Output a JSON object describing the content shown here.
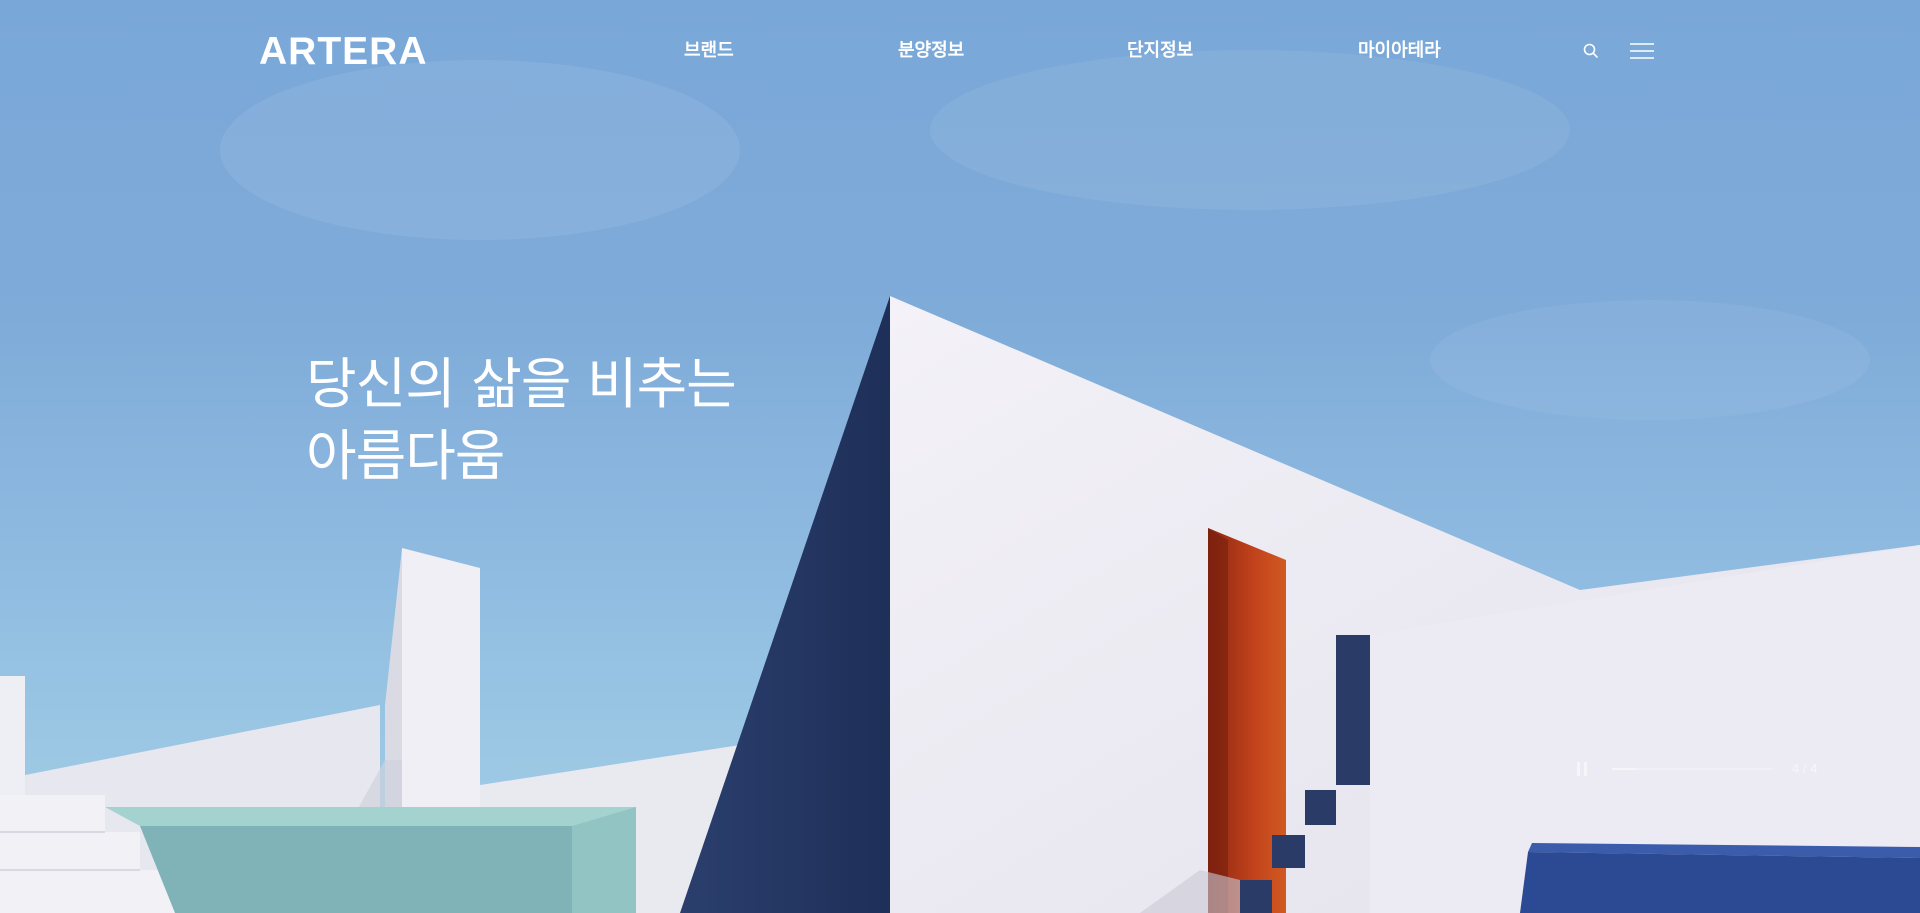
{
  "header": {
    "logo_text": "ARTERA",
    "nav": [
      {
        "label": "브랜드"
      },
      {
        "label": "분양정보"
      },
      {
        "label": "단지정보"
      },
      {
        "label": "마이아테라"
      }
    ],
    "icons": {
      "search": "search-icon",
      "menu": "hamburger-menu-icon"
    }
  },
  "hero": {
    "headline_line1": "당신의 삶을 비추는",
    "headline_line2": "아름다움",
    "slider": {
      "progress": 0.15,
      "counter": "4 / 4"
    }
  },
  "colors": {
    "sky": "#7fabd9",
    "wall": "#eceaf2",
    "shadow_navy": "#24365f",
    "door_red": "#b2381c",
    "pool_teal": "#86bfbf",
    "blue_block": "#2e4b94"
  }
}
